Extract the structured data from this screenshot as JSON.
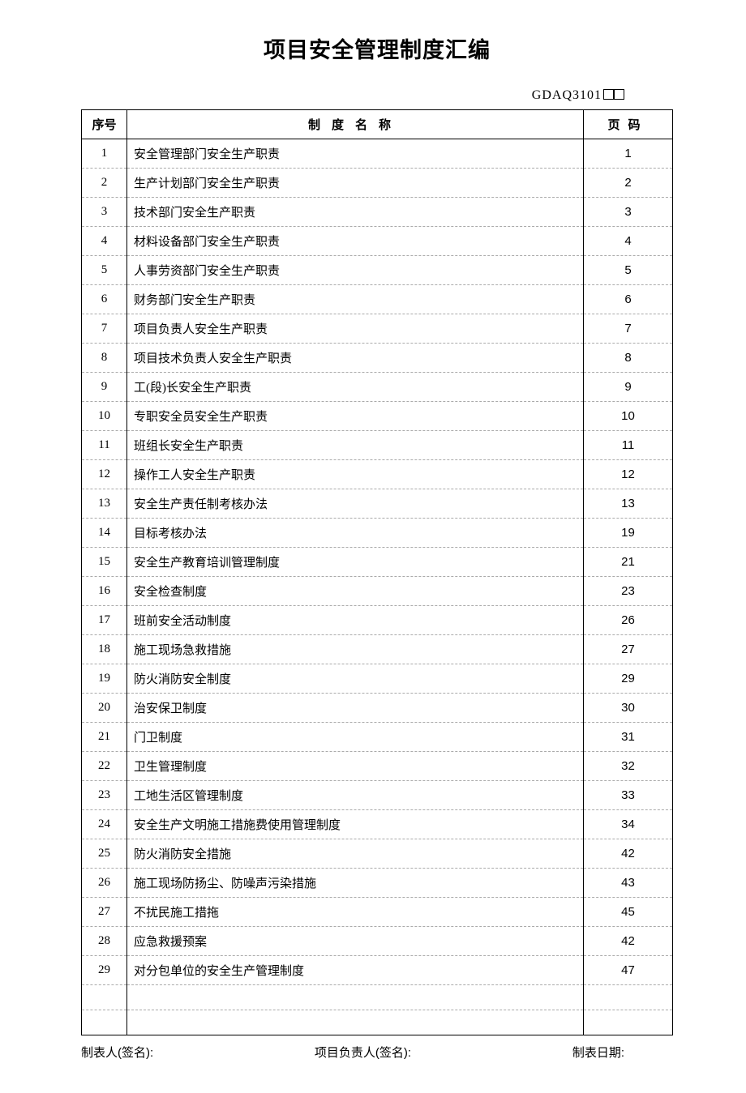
{
  "title": "项目安全管理制度汇编",
  "doc_code": "GDAQ3101",
  "table": {
    "headers": {
      "seq": "序号",
      "name": "制度名称",
      "page": "页码"
    },
    "rows": [
      {
        "seq": "1",
        "name": "安全管理部门安全生产职责",
        "page": "1"
      },
      {
        "seq": "2",
        "name": "生产计划部门安全生产职责",
        "page": "2"
      },
      {
        "seq": "3",
        "name": "技术部门安全生产职责",
        "page": "3"
      },
      {
        "seq": "4",
        "name": "材料设备部门安全生产职责",
        "page": "4"
      },
      {
        "seq": "5",
        "name": "人事劳资部门安全生产职责",
        "page": "5"
      },
      {
        "seq": "6",
        "name": "财务部门安全生产职责",
        "page": "6"
      },
      {
        "seq": "7",
        "name": "项目负责人安全生产职责",
        "page": "7"
      },
      {
        "seq": "8",
        "name": "项目技术负责人安全生产职责",
        "page": "8"
      },
      {
        "seq": "9",
        "name": "工(段)长安全生产职责",
        "page": "9"
      },
      {
        "seq": "10",
        "name": "专职安全员安全生产职责",
        "page": "10"
      },
      {
        "seq": "11",
        "name": "班组长安全生产职责",
        "page": "11"
      },
      {
        "seq": "12",
        "name": "操作工人安全生产职责",
        "page": "12"
      },
      {
        "seq": "13",
        "name": "安全生产责任制考核办法",
        "page": "13"
      },
      {
        "seq": "14",
        "name": "目标考核办法",
        "page": "19"
      },
      {
        "seq": "15",
        "name": "安全生产教育培训管理制度",
        "page": "21"
      },
      {
        "seq": "16",
        "name": "安全检查制度",
        "page": "23"
      },
      {
        "seq": "17",
        "name": "班前安全活动制度",
        "page": "26"
      },
      {
        "seq": "18",
        "name": "施工现场急救措施",
        "page": "27"
      },
      {
        "seq": "19",
        "name": "防火消防安全制度",
        "page": "29"
      },
      {
        "seq": "20",
        "name": "治安保卫制度",
        "page": "30"
      },
      {
        "seq": "21",
        "name": "门卫制度",
        "page": "31"
      },
      {
        "seq": "22",
        "name": "卫生管理制度",
        "page": "32"
      },
      {
        "seq": "23",
        "name": "工地生活区管理制度",
        "page": "33"
      },
      {
        "seq": "24",
        "name": "安全生产文明施工措施费使用管理制度",
        "page": "34"
      },
      {
        "seq": "25",
        "name": "防火消防安全措施",
        "page": "42"
      },
      {
        "seq": "26",
        "name": "施工现场防扬尘、防噪声污染措施",
        "page": "43"
      },
      {
        "seq": "27",
        "name": "不扰民施工措拖",
        "page": "45"
      },
      {
        "seq": "28",
        "name": "应急救援预案",
        "page": "42"
      },
      {
        "seq": "29",
        "name": "对分包单位的安全生产管理制度",
        "page": "47"
      }
    ],
    "empty_rows": 2
  },
  "footer": {
    "preparer_label": "制表人(签名):",
    "manager_label": "项目负责人(签名):",
    "date_label": "制表日期:"
  }
}
